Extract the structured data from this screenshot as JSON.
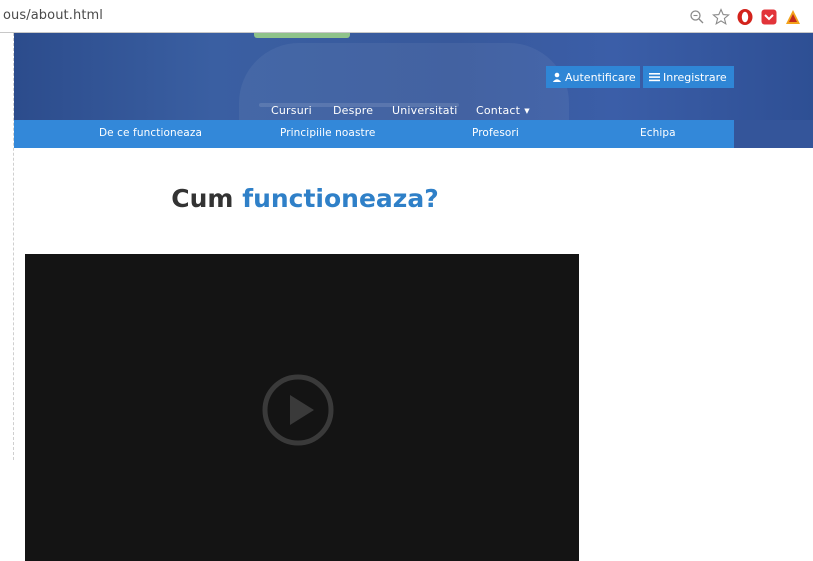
{
  "browser": {
    "url": "ous/about.html",
    "icons": [
      "zoom-icon",
      "star-icon",
      "opera-icon",
      "pocket-icon",
      "acrobat-icon"
    ]
  },
  "header": {
    "nav": [
      {
        "label": "Cursuri"
      },
      {
        "label": "Despre"
      },
      {
        "label": "Universitati"
      },
      {
        "label": "Contact",
        "has_dropdown": true
      }
    ],
    "login_label": "Autentificare",
    "register_label": "Inregistrare"
  },
  "subnav": {
    "items": [
      {
        "label": "De ce functioneaza"
      },
      {
        "label": "Principiile noastre"
      },
      {
        "label": "Profesori"
      },
      {
        "label": "Echipa"
      }
    ]
  },
  "main": {
    "heading_plain": "Cum",
    "heading_accent": "functioneaza?"
  },
  "colors": {
    "accent": "#2f80c8",
    "nav_bar": "#3388d9",
    "hero": "#3a5fa2",
    "video_bg": "#141414"
  }
}
